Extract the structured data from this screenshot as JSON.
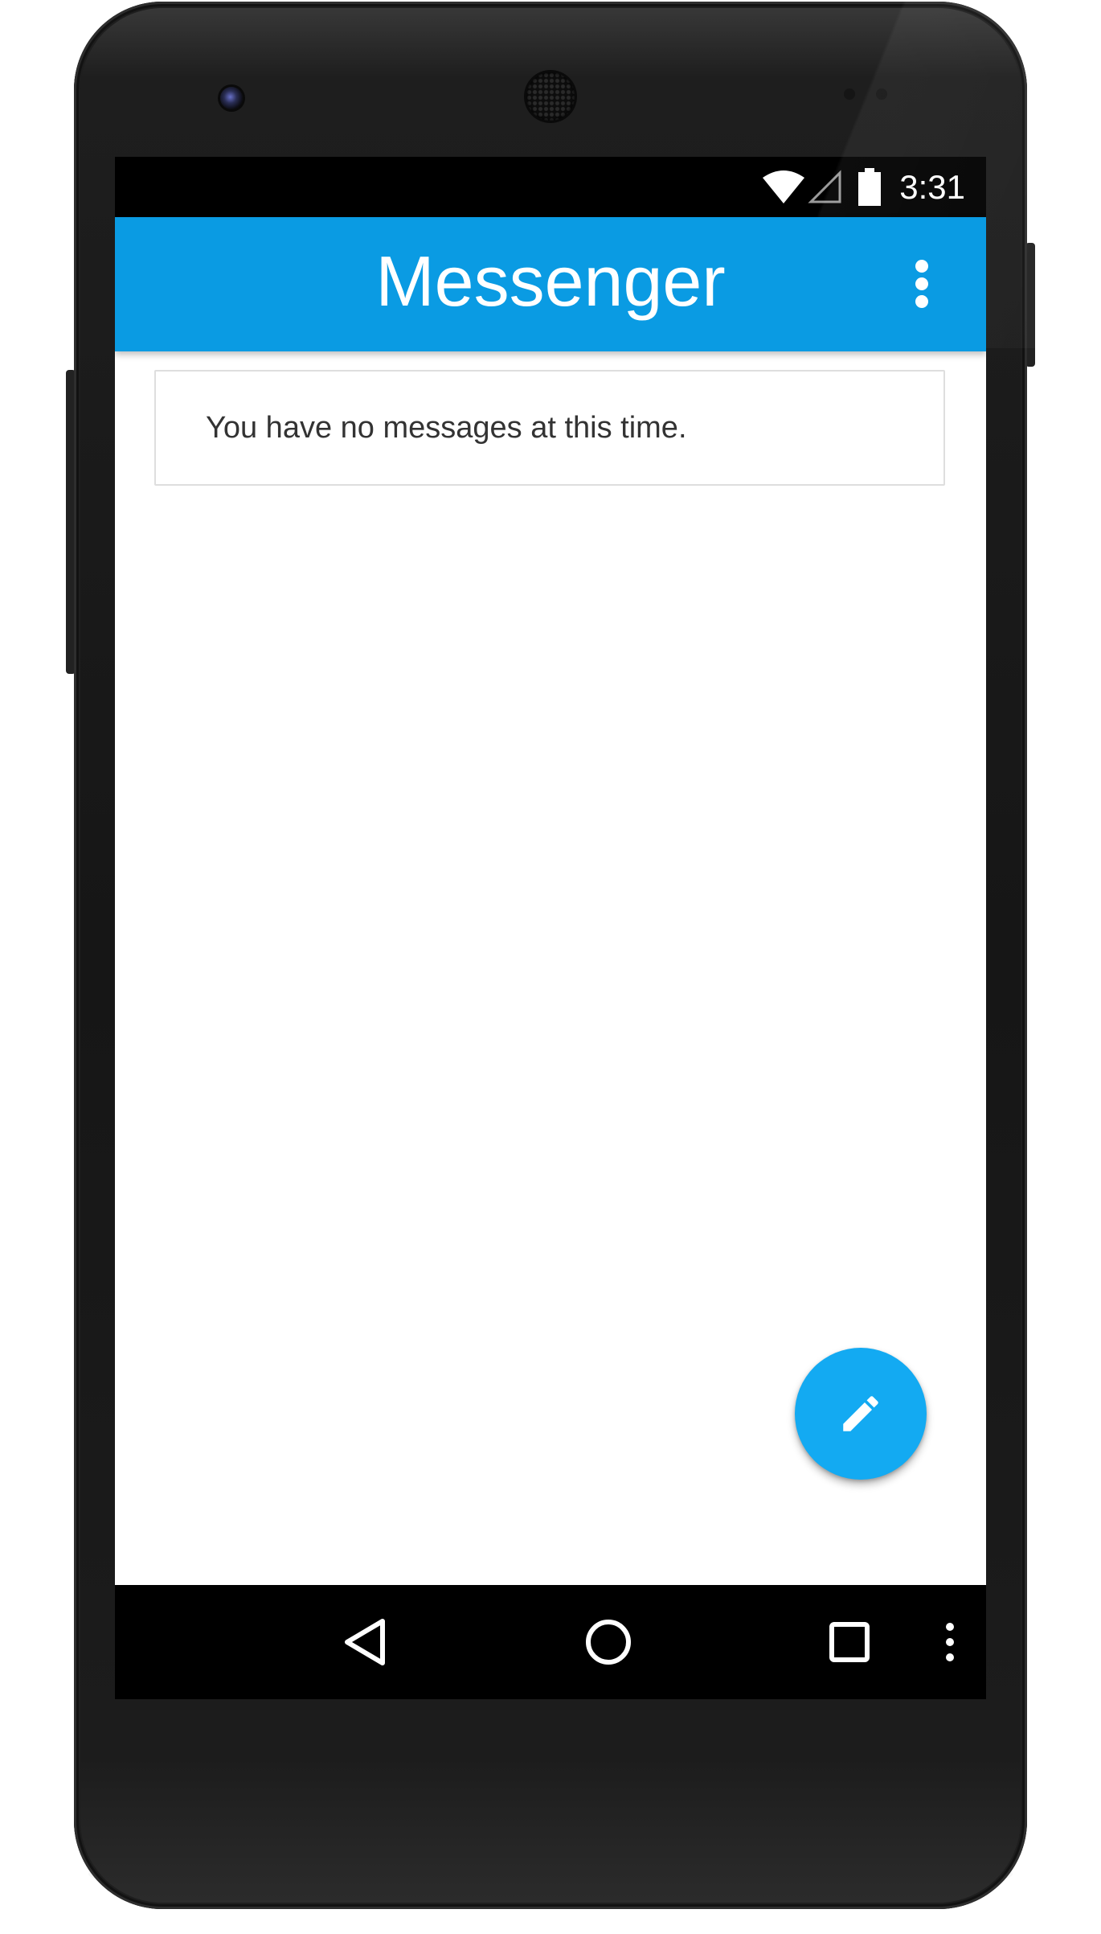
{
  "status_bar": {
    "time": "3:31",
    "icons": [
      "wifi-icon",
      "cell-signal-icon",
      "battery-icon"
    ]
  },
  "app_bar": {
    "title": "Messenger",
    "overflow_icon": "more-vert-icon",
    "background": "#0a9be3"
  },
  "main": {
    "empty_message": "You have no messages at this time."
  },
  "fab": {
    "icon": "pencil-icon",
    "color": "#13aaf2"
  },
  "nav_bar": {
    "buttons": [
      "back-icon",
      "home-icon",
      "recents-icon",
      "menu-icon"
    ]
  }
}
